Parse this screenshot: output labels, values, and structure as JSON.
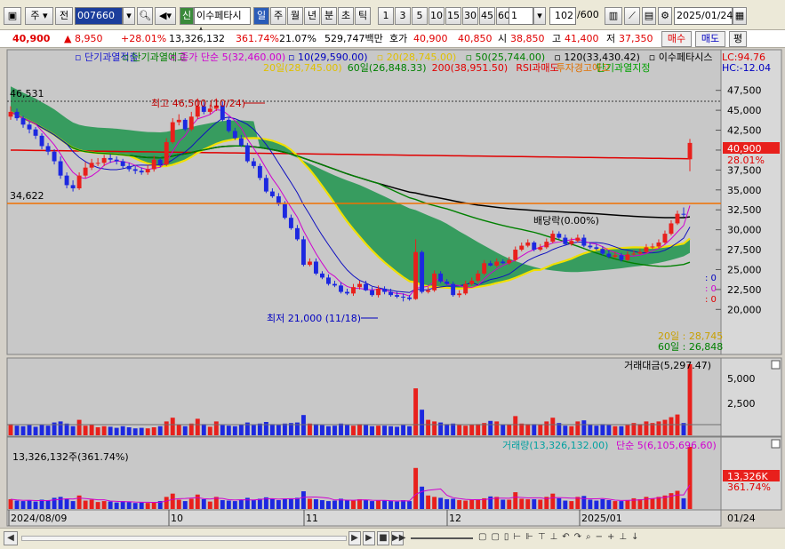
{
  "toolbar": {
    "period_label": "주",
    "prev_label": "전",
    "code": "007660",
    "stock_name": "이수페타시스",
    "credit_tag": "신",
    "period_tabs": [
      "일",
      "주",
      "월",
      "년",
      "분",
      "초",
      "틱"
    ],
    "intervals": [
      "1",
      "3",
      "5",
      "10",
      "15",
      "30",
      "45",
      "60"
    ],
    "interval_value": "1",
    "count": "102",
    "count_total": "/600",
    "date": "2025/01/24"
  },
  "quote": {
    "price": "40,900",
    "change": "▲ 8,950",
    "change_pct": "+28.01%",
    "volume": "13,326,132",
    "vol_ratio": "361.74%",
    "turnover": "21.07%",
    "amount": "529,747백만",
    "ask_label": "호가",
    "ask": "40,900",
    "bid": "40,850",
    "open_label": "시",
    "open": "38,850",
    "high_label": "고",
    "high": "41,400",
    "low_label": "저",
    "low": "37,350",
    "buy_label": "매수",
    "sell_label": "매도",
    "eval_label": "평"
  },
  "legend": {
    "row1": [
      {
        "text": "단기과열적출",
        "color": "#1a1ad0"
      },
      {
        "text": "단기과열예고",
        "color": "#008000"
      },
      {
        "text": "종가 단순 5(32,460.00)",
        "color": "#d000d0"
      },
      {
        "text": "10(29,590.00)",
        "color": "#0000c0"
      },
      {
        "text": "20(28,745.00)",
        "color": "#e0c000"
      },
      {
        "text": "50(25,744.00)",
        "color": "#008000"
      },
      {
        "text": "120(33,430.42)",
        "color": "#000000"
      },
      {
        "text": "이수페타시스",
        "color": "#000000"
      }
    ],
    "row2": [
      {
        "text": "20일(28,745.00)",
        "color": "#e0c000"
      },
      {
        "text": "60일(26,848.33)",
        "color": "#008000"
      },
      {
        "text": "200(38,951.50)",
        "color": "#e00000"
      },
      {
        "text": "RSI과매도",
        "color": "#e00000"
      },
      {
        "text": "투자경고예고",
        "color": "#e07000"
      },
      {
        "text": "단기과열지정",
        "color": "#00a000"
      }
    ],
    "lc": "LC:94.76",
    "hc": "HC:-12.04"
  },
  "annotations": {
    "high_label": "최고 46,500 (10/24)",
    "low_label": "최저 21,000 (11/18)",
    "dividend": "배당락(0.00%)",
    "level_high": "46,531",
    "level_mid": "34,622",
    "price_tag": "40,900",
    "pct_tag": "28.01%",
    "ma20_tag": "20일 : 28,745",
    "ma60_tag": "60일 : 26,848",
    "zero1": ": 0",
    "zero2": ": 0",
    "zero3": ": 0"
  },
  "panels": {
    "amount_title": "거래대금(5,297.47)",
    "volume_title": "거래량(13,326,132.00)",
    "volume_ma": "단순 5(6,105,696.60)",
    "volume_left": "13,326,132주(361.74%)",
    "volume_tag": "13,326K",
    "volume_pct": "361.74%"
  },
  "axes": {
    "price_ticks": [
      "47,500",
      "45,000",
      "42,500",
      "40,000",
      "37,500",
      "35,000",
      "32,500",
      "30,000",
      "27,500",
      "25,000",
      "22,500",
      "20,000"
    ],
    "amount_ticks": [
      "5,000",
      "2,500"
    ],
    "date_labels": [
      "2024/08/09",
      "10",
      "11",
      "12",
      "2025/01"
    ],
    "date_right": "01/24"
  },
  "colors": {
    "up": "#e8201c",
    "down": "#1c28e0",
    "bg": "#c8c8c8",
    "cloud": "#2f9a5a",
    "ma120": "#000000",
    "ma200": "#e00000"
  },
  "chart_data": {
    "type": "candlestick",
    "title": "이수페타시스",
    "period": "daily",
    "x": [
      "2024-08-09",
      "2024-08-13",
      "2024-08-14",
      "2024-08-16",
      "2024-08-19",
      "2024-08-20",
      "2024-08-21",
      "2024-08-22",
      "2024-08-23",
      "2024-08-26",
      "2024-08-27",
      "2024-08-28",
      "2024-08-29",
      "2024-08-30",
      "2024-09-02",
      "2024-09-03",
      "2024-09-04",
      "2024-09-05",
      "2024-09-06",
      "2024-09-09",
      "2024-09-10",
      "2024-09-11",
      "2024-09-12",
      "2024-09-13",
      "2024-09-19",
      "2024-09-20",
      "2024-09-23",
      "2024-09-24",
      "2024-09-25",
      "2024-09-26",
      "2024-09-27",
      "2024-09-30",
      "2024-10-02",
      "2024-10-04",
      "2024-10-07",
      "2024-10-08",
      "2024-10-10",
      "2024-10-11",
      "2024-10-14",
      "2024-10-15",
      "2024-10-16",
      "2024-10-17",
      "2024-10-18",
      "2024-10-21",
      "2024-10-22",
      "2024-10-23",
      "2024-10-24",
      "2024-10-25",
      "2024-10-28",
      "2024-10-29",
      "2024-10-30",
      "2024-10-31",
      "2024-11-01",
      "2024-11-04",
      "2024-11-05",
      "2024-11-06",
      "2024-11-07",
      "2024-11-08",
      "2024-11-11",
      "2024-11-12",
      "2024-11-13",
      "2024-11-14",
      "2024-11-15",
      "2024-11-18",
      "2024-11-19",
      "2024-11-20",
      "2024-11-21",
      "2024-11-22",
      "2024-11-25",
      "2024-11-26",
      "2024-11-27",
      "2024-11-28",
      "2024-11-29",
      "2024-12-02",
      "2024-12-03",
      "2024-12-04",
      "2024-12-05",
      "2024-12-06",
      "2024-12-09",
      "2024-12-10",
      "2024-12-11",
      "2024-12-12",
      "2024-12-13",
      "2024-12-16",
      "2024-12-17",
      "2024-12-18",
      "2024-12-19",
      "2024-12-20",
      "2024-12-23",
      "2024-12-24",
      "2024-12-26",
      "2024-12-27",
      "2024-12-30",
      "2025-01-02",
      "2025-01-03",
      "2025-01-06",
      "2025-01-07",
      "2025-01-08",
      "2025-01-09",
      "2025-01-10",
      "2025-01-13",
      "2025-01-14",
      "2025-01-15",
      "2025-01-16",
      "2025-01-17",
      "2025-01-20",
      "2025-01-21",
      "2025-01-22",
      "2025-01-23",
      "2025-01-24"
    ],
    "open": [
      44200,
      44800,
      44000,
      43200,
      42600,
      41800,
      40500,
      39800,
      38600,
      36800,
      35600,
      35200,
      36800,
      37800,
      38400,
      38400,
      39000,
      38800,
      38600,
      38000,
      37600,
      37400,
      37200,
      37600,
      38800,
      38200,
      41000,
      43500,
      43800,
      42600,
      44200,
      45500,
      44800,
      45200,
      45600,
      43800,
      42400,
      41500,
      40600,
      38600,
      38000,
      36500,
      34800,
      34200,
      33200,
      31500,
      30200,
      28800,
      25600,
      26000,
      24500,
      24000,
      23200,
      23000,
      22200,
      22000,
      22800,
      23200,
      22400,
      21800,
      22600,
      22200,
      21800,
      21600,
      21500,
      21300,
      27200,
      22200,
      22400,
      24500,
      23500,
      23200,
      21800,
      22000,
      23200,
      23600,
      24500,
      25800,
      25500,
      26000,
      25800,
      26200,
      27500,
      28000,
      28400,
      27500,
      27800,
      28500,
      29500,
      29000,
      28200,
      28600,
      29000,
      28000,
      27800,
      27600,
      27000,
      26600,
      26800,
      26200,
      26900,
      27000,
      27200,
      27800,
      27900,
      28400,
      29500,
      30800,
      32000,
      38850
    ],
    "close": [
      44800,
      44000,
      43200,
      42600,
      41800,
      40500,
      39800,
      38600,
      36800,
      35600,
      35200,
      36800,
      37800,
      38400,
      38400,
      39000,
      38800,
      38600,
      38000,
      37600,
      37400,
      37200,
      37600,
      38800,
      38200,
      41000,
      43500,
      43800,
      42600,
      44200,
      45500,
      44800,
      45200,
      45600,
      43800,
      42400,
      41500,
      40600,
      38600,
      38000,
      36500,
      34800,
      34200,
      33200,
      31500,
      30200,
      28800,
      25600,
      26000,
      24500,
      24000,
      23200,
      23000,
      22200,
      22000,
      22800,
      23200,
      22400,
      21800,
      22600,
      22200,
      21800,
      21600,
      21500,
      21300,
      27200,
      22200,
      22400,
      24500,
      23500,
      23200,
      21800,
      22000,
      23200,
      23600,
      24500,
      25800,
      25500,
      26000,
      25800,
      26200,
      27500,
      28000,
      28400,
      27500,
      27800,
      28500,
      29500,
      29000,
      28200,
      28600,
      29000,
      28000,
      27800,
      27600,
      27000,
      26600,
      26800,
      26200,
      26900,
      27000,
      27200,
      27800,
      27900,
      28400,
      29500,
      30800,
      32000,
      31950,
      40900
    ],
    "high": [
      45500,
      45200,
      44300,
      43600,
      42900,
      42100,
      40900,
      40100,
      39200,
      37200,
      36200,
      37200,
      38500,
      38900,
      39000,
      39400,
      39500,
      39200,
      38900,
      38400,
      38000,
      37800,
      38100,
      39300,
      39000,
      41500,
      44000,
      44500,
      44000,
      44800,
      46500,
      46000,
      45700,
      46500,
      46100,
      44200,
      42800,
      41900,
      40900,
      39000,
      38300,
      36900,
      35200,
      34600,
      33600,
      31900,
      30600,
      29200,
      26400,
      26400,
      24800,
      24400,
      23600,
      23400,
      22600,
      23200,
      23600,
      23600,
      22800,
      23000,
      22900,
      22600,
      22200,
      22000,
      21800,
      28800,
      27400,
      22800,
      24900,
      24800,
      23800,
      23500,
      22400,
      23600,
      24000,
      24900,
      26200,
      26100,
      26400,
      26300,
      26600,
      27900,
      28400,
      28800,
      28600,
      28200,
      28900,
      29900,
      29800,
      29400,
      29000,
      29400,
      29400,
      28400,
      28200,
      27900,
      27400,
      27200,
      27100,
      27300,
      27400,
      27600,
      28200,
      28300,
      28800,
      29900,
      31200,
      32400,
      32800,
      41400
    ],
    "low": [
      43800,
      43700,
      42800,
      42100,
      41400,
      40100,
      39400,
      38200,
      36400,
      35200,
      34800,
      35000,
      36500,
      37500,
      38000,
      38000,
      38400,
      38200,
      37700,
      37300,
      37000,
      36900,
      36900,
      37300,
      37900,
      38000,
      40800,
      43100,
      42400,
      42400,
      43900,
      44500,
      44500,
      44900,
      43600,
      42200,
      41300,
      40400,
      38400,
      37700,
      36200,
      34600,
      34000,
      33000,
      31300,
      30000,
      28600,
      25400,
      25400,
      24300,
      23800,
      23000,
      22800,
      22000,
      21800,
      21700,
      22500,
      22300,
      21600,
      21500,
      21900,
      21600,
      21400,
      21000,
      21100,
      21200,
      22000,
      22000,
      22200,
      23300,
      23100,
      21600,
      21500,
      21800,
      23000,
      23400,
      24300,
      25400,
      25300,
      25700,
      25600,
      26000,
      27300,
      27800,
      27300,
      27300,
      27600,
      28300,
      28800,
      28000,
      28000,
      28400,
      27800,
      27600,
      27400,
      26800,
      26400,
      26400,
      26000,
      26100,
      26800,
      26900,
      27000,
      27600,
      27700,
      28200,
      29300,
      30600,
      31600,
      37350
    ],
    "volume_k": [
      2100,
      1800,
      1700,
      1900,
      1600,
      2000,
      1800,
      2400,
      2600,
      2200,
      1700,
      2900,
      1800,
      2000,
      1500,
      1700,
      1600,
      1400,
      1700,
      1500,
      1300,
      1400,
      1300,
      1500,
      1700,
      2600,
      3300,
      2000,
      1700,
      2200,
      3100,
      2100,
      1600,
      2600,
      1900,
      1800,
      1700,
      2000,
      2400,
      1900,
      2200,
      2500,
      2100,
      1900,
      2200,
      2300,
      2400,
      3800,
      2200,
      2100,
      1900,
      1700,
      1800,
      2200,
      1900,
      1800,
      2100,
      1900,
      1700,
      1800,
      1800,
      1700,
      1600,
      1900,
      1700,
      8800,
      4800,
      2900,
      2600,
      2400,
      2100,
      2200,
      1900,
      1800,
      2000,
      2100,
      2300,
      2700,
      2600,
      2000,
      2000,
      3600,
      2200,
      2100,
      2100,
      2000,
      2600,
      3300,
      2300,
      1800,
      1700,
      2600,
      2800,
      2000,
      1800,
      2100,
      1900,
      1700,
      1700,
      1900,
      2300,
      2100,
      2600,
      2300,
      2600,
      2900,
      3400,
      3900,
      2300,
      13326
    ]
  }
}
